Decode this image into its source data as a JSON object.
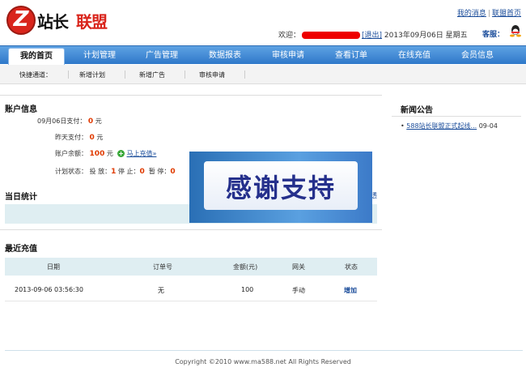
{
  "logo": {
    "letter": "Z",
    "part1": "站长",
    "part2": "联盟"
  },
  "toplinks": {
    "my_messages": "我的消息",
    "sep": "|",
    "home": "联盟首页"
  },
  "header": {
    "welcome": "欢迎：",
    "logout": "[退出]",
    "date": "2013年09月06日 星期五",
    "service": "客服："
  },
  "nav": [
    "我的首页",
    "计划管理",
    "广告管理",
    "数据报表",
    "审核申请",
    "查看订单",
    "在线充值",
    "会员信息"
  ],
  "subnav": {
    "label": "快捷通道：",
    "items": [
      "新增计划",
      "新增广告",
      "审核申请"
    ]
  },
  "account": {
    "title": "账户信息",
    "today_label": "09月06日支付：",
    "today_value": "0",
    "today_unit": "元",
    "yesterday_label": "昨天支付：",
    "yesterday_value": "0",
    "yesterday_unit": "元",
    "balance_label": "账户余额：",
    "balance_value": "100",
    "balance_unit": "元",
    "recharge": "马上充值»",
    "status_label": "计划状态：",
    "running_label": "投 放：",
    "running": "1",
    "stopped_label": "停 止：",
    "stopped": "0",
    "paused_label": "暂 停：",
    "paused": "0"
  },
  "banner": {
    "text": "感谢支持"
  },
  "today_stats": {
    "title": "当日统计",
    "link": "透"
  },
  "news": {
    "title": "新闻公告",
    "items": [
      {
        "text": "588站长联盟正式起线...",
        "date": "09-04"
      }
    ]
  },
  "recharge": {
    "title": "最近充值",
    "columns": [
      "日期",
      "订单号",
      "金额(元)",
      "网关",
      "状态"
    ],
    "rows": [
      {
        "date": "2013-09-06 03:56:30",
        "order": "无",
        "amount": "100",
        "gateway": "手动",
        "status": "增加"
      }
    ]
  },
  "footer": "Copyright ©2010 www.ma588.net All Rights Reserved"
}
